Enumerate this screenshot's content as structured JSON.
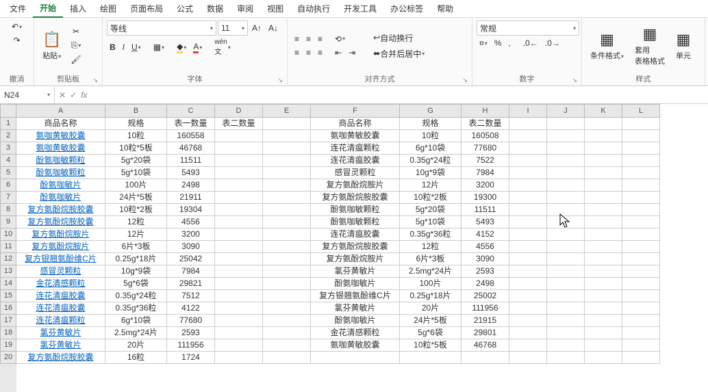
{
  "menu": {
    "items": [
      "文件",
      "开始",
      "插入",
      "绘图",
      "页面布局",
      "公式",
      "数据",
      "审阅",
      "视图",
      "自动执行",
      "开发工具",
      "办公标签",
      "帮助"
    ],
    "active": 1
  },
  "ribbon": {
    "undo_label": "撤消",
    "clipboard_label": "剪贴板",
    "paste_label": "粘贴",
    "font_label": "字体",
    "font_name": "等线",
    "font_size": "11",
    "align_label": "对齐方式",
    "wrap_label": "自动换行",
    "merge_label": "合并后居中",
    "number_label": "数字",
    "number_format": "常规",
    "styles_label": "样式",
    "cond_fmt": "条件格式",
    "table_fmt": "套用\n表格格式",
    "cell_styles": "单元"
  },
  "namebox": "N24",
  "cols": [
    "A",
    "B",
    "C",
    "D",
    "E",
    "F",
    "G",
    "H",
    "I",
    "J",
    "K",
    "L"
  ],
  "col_widths": [
    "cw-A",
    "cw-B",
    "cw-C",
    "cw-D",
    "cw-E",
    "cw-F",
    "cw-G",
    "cw-H",
    "cw-I",
    "cw-J",
    "cw-K",
    "cw-L"
  ],
  "chart_data": {
    "type": "table",
    "left": {
      "headers": [
        "商品名称",
        "规格",
        "表一数量",
        "表二数量"
      ],
      "rows": [
        [
          "氨咖黄敏胶囊",
          "10粒",
          "160558",
          ""
        ],
        [
          "氨咖黄敏胶囊",
          "10粒*5板",
          "46768",
          ""
        ],
        [
          "酚氨咖敏颗粒",
          "5g*20袋",
          "11511",
          ""
        ],
        [
          "酚氨咖敏颗粒",
          "5g*10袋",
          "5493",
          ""
        ],
        [
          "酚氨咖敏片",
          "100片",
          "2498",
          ""
        ],
        [
          "酚氨咖敏片",
          "24片*5板",
          "21911",
          ""
        ],
        [
          "复方氨酚烷胺胶囊",
          "10粒*2板",
          "19304",
          ""
        ],
        [
          "复方氨酚烷胺胶囊",
          "12粒",
          "4556",
          ""
        ],
        [
          "复方氨酚烷胺片",
          "12片",
          "3200",
          ""
        ],
        [
          "复方氨酚烷胺片",
          "6片*3板",
          "3090",
          ""
        ],
        [
          "复方银翘氨酚维C片",
          "0.25g*18片",
          "25042",
          ""
        ],
        [
          "感冒灵颗粒",
          "10g*9袋",
          "7984",
          ""
        ],
        [
          "金花清感颗粒",
          "5g*6袋",
          "29821",
          ""
        ],
        [
          "连花清瘟胶囊",
          "0.35g*24粒",
          "7512",
          ""
        ],
        [
          "连花清瘟胶囊",
          "0.35g*36粒",
          "4122",
          ""
        ],
        [
          "连花清瘟颗粒",
          "6g*10袋",
          "77680",
          ""
        ],
        [
          "氯芬黄敏片",
          "2.5mg*24片",
          "2593",
          ""
        ],
        [
          "氯芬黄敏片",
          "20片",
          "111956",
          ""
        ],
        [
          "复方氨酚烷胺胶囊",
          "16粒",
          "1724",
          ""
        ]
      ]
    },
    "right": {
      "headers": [
        "商品名称",
        "规格",
        "表二数量"
      ],
      "rows": [
        [
          "氨咖黄敏胶囊",
          "10粒",
          "160508"
        ],
        [
          "连花清瘟颗粒",
          "6g*10袋",
          "77680"
        ],
        [
          "连花清瘟胶囊",
          "0.35g*24粒",
          "7522"
        ],
        [
          "感冒灵颗粒",
          "10g*9袋",
          "7984"
        ],
        [
          "复方氨酚烷胺片",
          "12片",
          "3200"
        ],
        [
          "复方氨酚烷胺胶囊",
          "10粒*2板",
          "19300"
        ],
        [
          "酚氨咖敏颗粒",
          "5g*20袋",
          "11511"
        ],
        [
          "酚氨咖敏颗粒",
          "5g*10袋",
          "5493"
        ],
        [
          "连花清瘟胶囊",
          "0.35g*36粒",
          "4152"
        ],
        [
          "复方氨酚烷胺胶囊",
          "12粒",
          "4556"
        ],
        [
          "复方氨酚烷胺片",
          "6片*3板",
          "3090"
        ],
        [
          "氯芬黄敏片",
          "2.5mg*24片",
          "2593"
        ],
        [
          "酚氨咖敏片",
          "100片",
          "2498"
        ],
        [
          "复方银翘氨酚维C片",
          "0.25g*18片",
          "25002"
        ],
        [
          "氯芬黄敏片",
          "20片",
          "111956"
        ],
        [
          "酚氨咖敏片",
          "24片*5板",
          "21915"
        ],
        [
          "金花清感颗粒",
          "5g*6袋",
          "29801"
        ],
        [
          "氨咖黄敏胶囊",
          "10粒*5板",
          "46768"
        ],
        [
          "",
          "",
          ""
        ]
      ]
    }
  }
}
